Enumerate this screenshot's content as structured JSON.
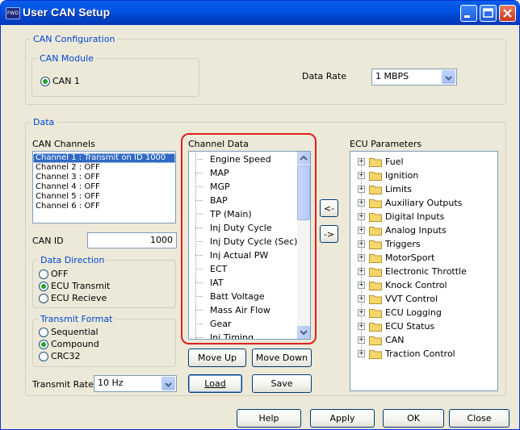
{
  "window": {
    "title": "User CAN Setup",
    "icon": "app-icon",
    "icon_text": "FWD"
  },
  "can_configuration": {
    "legend": "CAN Configuration",
    "module_legend": "CAN Module",
    "module_option": "CAN 1",
    "data_rate_label": "Data Rate",
    "data_rate_value": "1 MBPS"
  },
  "data": {
    "legend": "Data",
    "can_channels": {
      "label": "CAN Channels",
      "items": [
        "Channel 1 : Transmit on ID 1000",
        "Channel 2 : OFF",
        "Channel 3 : OFF",
        "Channel 4 : OFF",
        "Channel 5 : OFF",
        "Channel 6 : OFF"
      ],
      "selected_index": 0
    },
    "can_id": {
      "label": "CAN ID",
      "value": "1000"
    },
    "data_direction": {
      "legend": "Data Direction",
      "options": [
        "OFF",
        "ECU Transmit",
        "ECU Recieve"
      ],
      "selected": "ECU Transmit"
    },
    "transmit_format": {
      "legend": "Transmit Format",
      "options": [
        "Sequential",
        "Compound",
        "CRC32"
      ],
      "selected": "Compound"
    },
    "transmit_rate": {
      "label": "Transmit Rate",
      "value": "10 Hz"
    },
    "channel_data": {
      "label": "Channel Data",
      "items": [
        "Engine Speed",
        "MAP",
        "MGP",
        "BAP",
        "TP (Main)",
        "Inj Duty Cycle",
        "Inj Duty Cycle (Sec)",
        "Inj Actual PW",
        "ECT",
        "IAT",
        "Batt Voltage",
        "Mass Air Flow",
        "Gear",
        "Inj Timing"
      ]
    },
    "buttons": {
      "move_left": "<-",
      "move_right": "->",
      "move_up": "Move Up",
      "move_down": "Move Down",
      "load": "Load",
      "save": "Save"
    },
    "ecu_parameters": {
      "label": "ECU Parameters",
      "items": [
        "Fuel",
        "Ignition",
        "Limits",
        "Auxiliary Outputs",
        "Digital Inputs",
        "Analog Inputs",
        "Triggers",
        "MotorSport",
        "Electronic Throttle",
        "Knock Control",
        "VVT Control",
        "ECU Logging",
        "ECU Status",
        "CAN",
        "Traction Control"
      ]
    }
  },
  "footer": {
    "help": "Help",
    "apply": "Apply",
    "ok": "OK",
    "close": "Close"
  },
  "colors": {
    "title_bar": "#0054E3",
    "legend_text": "#0046D5",
    "highlight": "#E02020",
    "selection": "#316AC5",
    "radio_dot": "#21A121"
  }
}
